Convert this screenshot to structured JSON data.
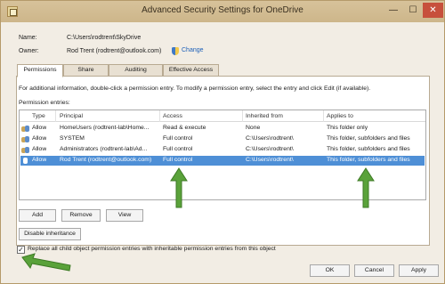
{
  "window": {
    "title": "Advanced Security Settings for OneDrive"
  },
  "titlebar_buttons": {
    "minimize": "—",
    "maximize": "☐",
    "close": "✕"
  },
  "name_field": {
    "label": "Name:",
    "value": "C:\\Users\\rodtrent\\SkyDrive"
  },
  "owner_field": {
    "label": "Owner:",
    "value": "Rod Trent (rodtrent@outlook.com)",
    "change_link": "Change"
  },
  "tabs": [
    {
      "label": "Permissions",
      "active": true
    },
    {
      "label": "Share",
      "active": false
    },
    {
      "label": "Auditing",
      "active": false
    },
    {
      "label": "Effective Access",
      "active": false
    }
  ],
  "info_text": "For additional information, double-click a permission entry. To modify a permission entry, select the entry and click Edit (if available).",
  "entries_label": "Permission entries:",
  "table": {
    "columns": [
      "Type",
      "Principal",
      "Access",
      "Inherited from",
      "Applies to"
    ],
    "rows": [
      {
        "icon": "group-icon",
        "type": "Allow",
        "principal": "HomeUsers (rodtrent-lab\\Home...",
        "access": "Read & execute",
        "inherited": "None",
        "applies": "This folder only",
        "selected": false
      },
      {
        "icon": "group-icon",
        "type": "Allow",
        "principal": "SYSTEM",
        "access": "Full control",
        "inherited": "C:\\Users\\rodtrent\\",
        "applies": "This folder, subfolders and files",
        "selected": false
      },
      {
        "icon": "group-icon",
        "type": "Allow",
        "principal": "Administrators (rodtrent-lab\\Ad...",
        "access": "Full control",
        "inherited": "C:\\Users\\rodtrent\\",
        "applies": "This folder, subfolders and files",
        "selected": false
      },
      {
        "icon": "user-icon",
        "type": "Allow",
        "principal": "Rod Trent (rodtrent@outlook.com)",
        "access": "Full control",
        "inherited": "C:\\Users\\rodtrent\\",
        "applies": "This folder, subfolders and files",
        "selected": true
      }
    ]
  },
  "buttons": {
    "add": "Add",
    "remove": "Remove",
    "view": "View",
    "disable_inheritance": "Disable inheritance",
    "ok": "OK",
    "cancel": "Cancel",
    "apply": "Apply"
  },
  "replace_checkbox": {
    "checked": true,
    "mark": "✓",
    "label": "Replace all child object permission entries with inheritable permission entries from this object"
  },
  "colors": {
    "selection": "#4e8fd6",
    "arrow": "#5aa23a",
    "frame": "#c9b48f"
  }
}
